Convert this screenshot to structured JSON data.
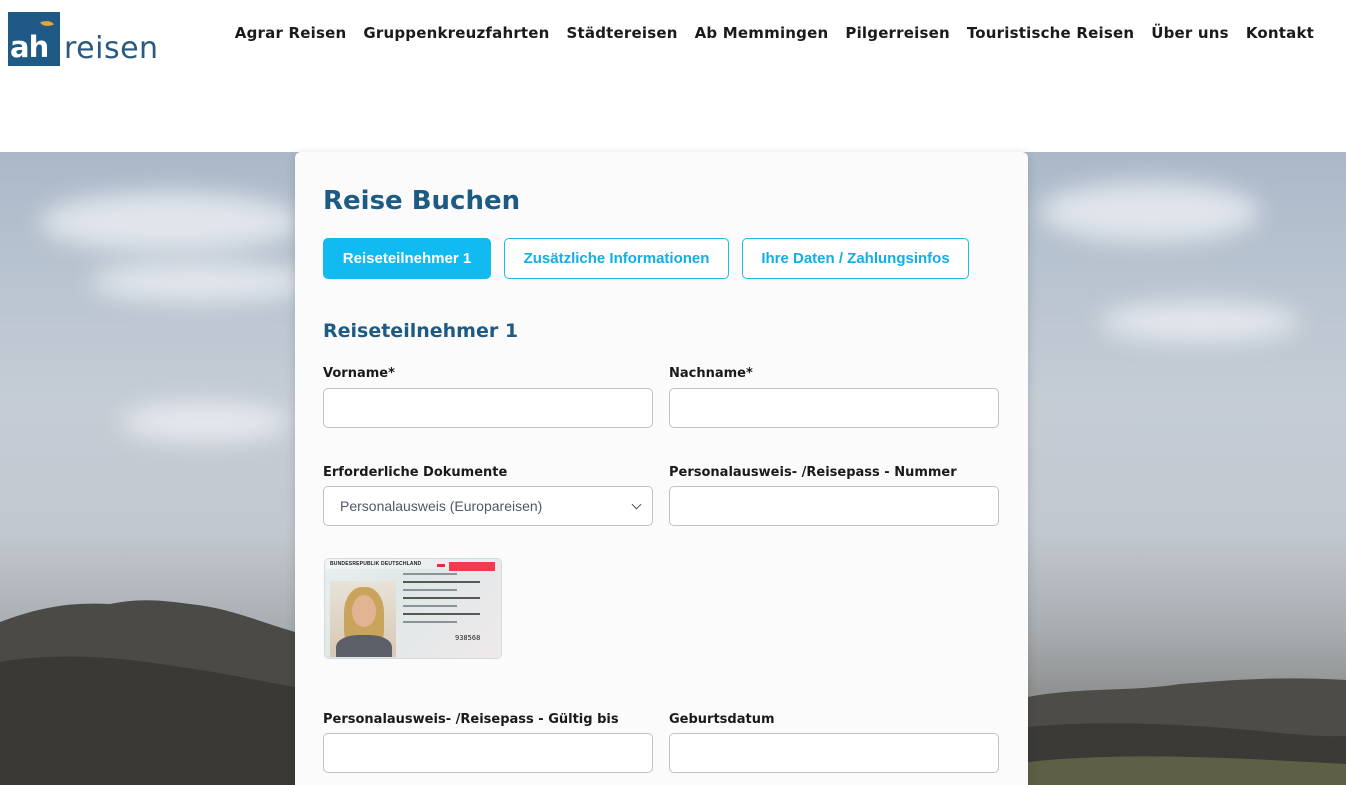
{
  "logo": {
    "mark": "ah",
    "word": "reisen"
  },
  "nav": [
    "Agrar Reisen",
    "Gruppenkreuzfahrten",
    "Städtereisen",
    "Ab Memmingen",
    "Pilgerreisen",
    "Touristische Reisen",
    "Über uns",
    "Kontakt"
  ],
  "card": {
    "title": "Reise Buchen",
    "tabs": [
      {
        "label": "Reiseteilnehmer 1",
        "active": true
      },
      {
        "label": "Zusätzliche Informationen",
        "active": false
      },
      {
        "label": "Ihre Daten / Zahlungsinfos",
        "active": false
      }
    ],
    "section_title": "Reiseteilnehmer 1",
    "fields": {
      "vorname": {
        "label": "Vorname*",
        "value": ""
      },
      "nachname": {
        "label": "Nachname*",
        "value": ""
      },
      "dokumente": {
        "label": "Erforderliche Dokumente",
        "value": "Personalausweis (Europareisen)"
      },
      "ausweisnummer": {
        "label": "Personalausweis- /Reisepass - Nummer",
        "value": ""
      },
      "gueltig_bis": {
        "label": "Personalausweis- /Reisepass - Gültig bis",
        "value": ""
      },
      "geburtsdatum": {
        "label": "Geburtsdatum",
        "value": ""
      }
    },
    "id_card": {
      "header": "BUNDESREPUBLIK DEUTSCHLAND",
      "serial": "938568"
    }
  },
  "colors": {
    "brand_blue": "#1d5b82",
    "accent_cyan": "#12baf2",
    "logo_orange": "#e8a33a"
  }
}
